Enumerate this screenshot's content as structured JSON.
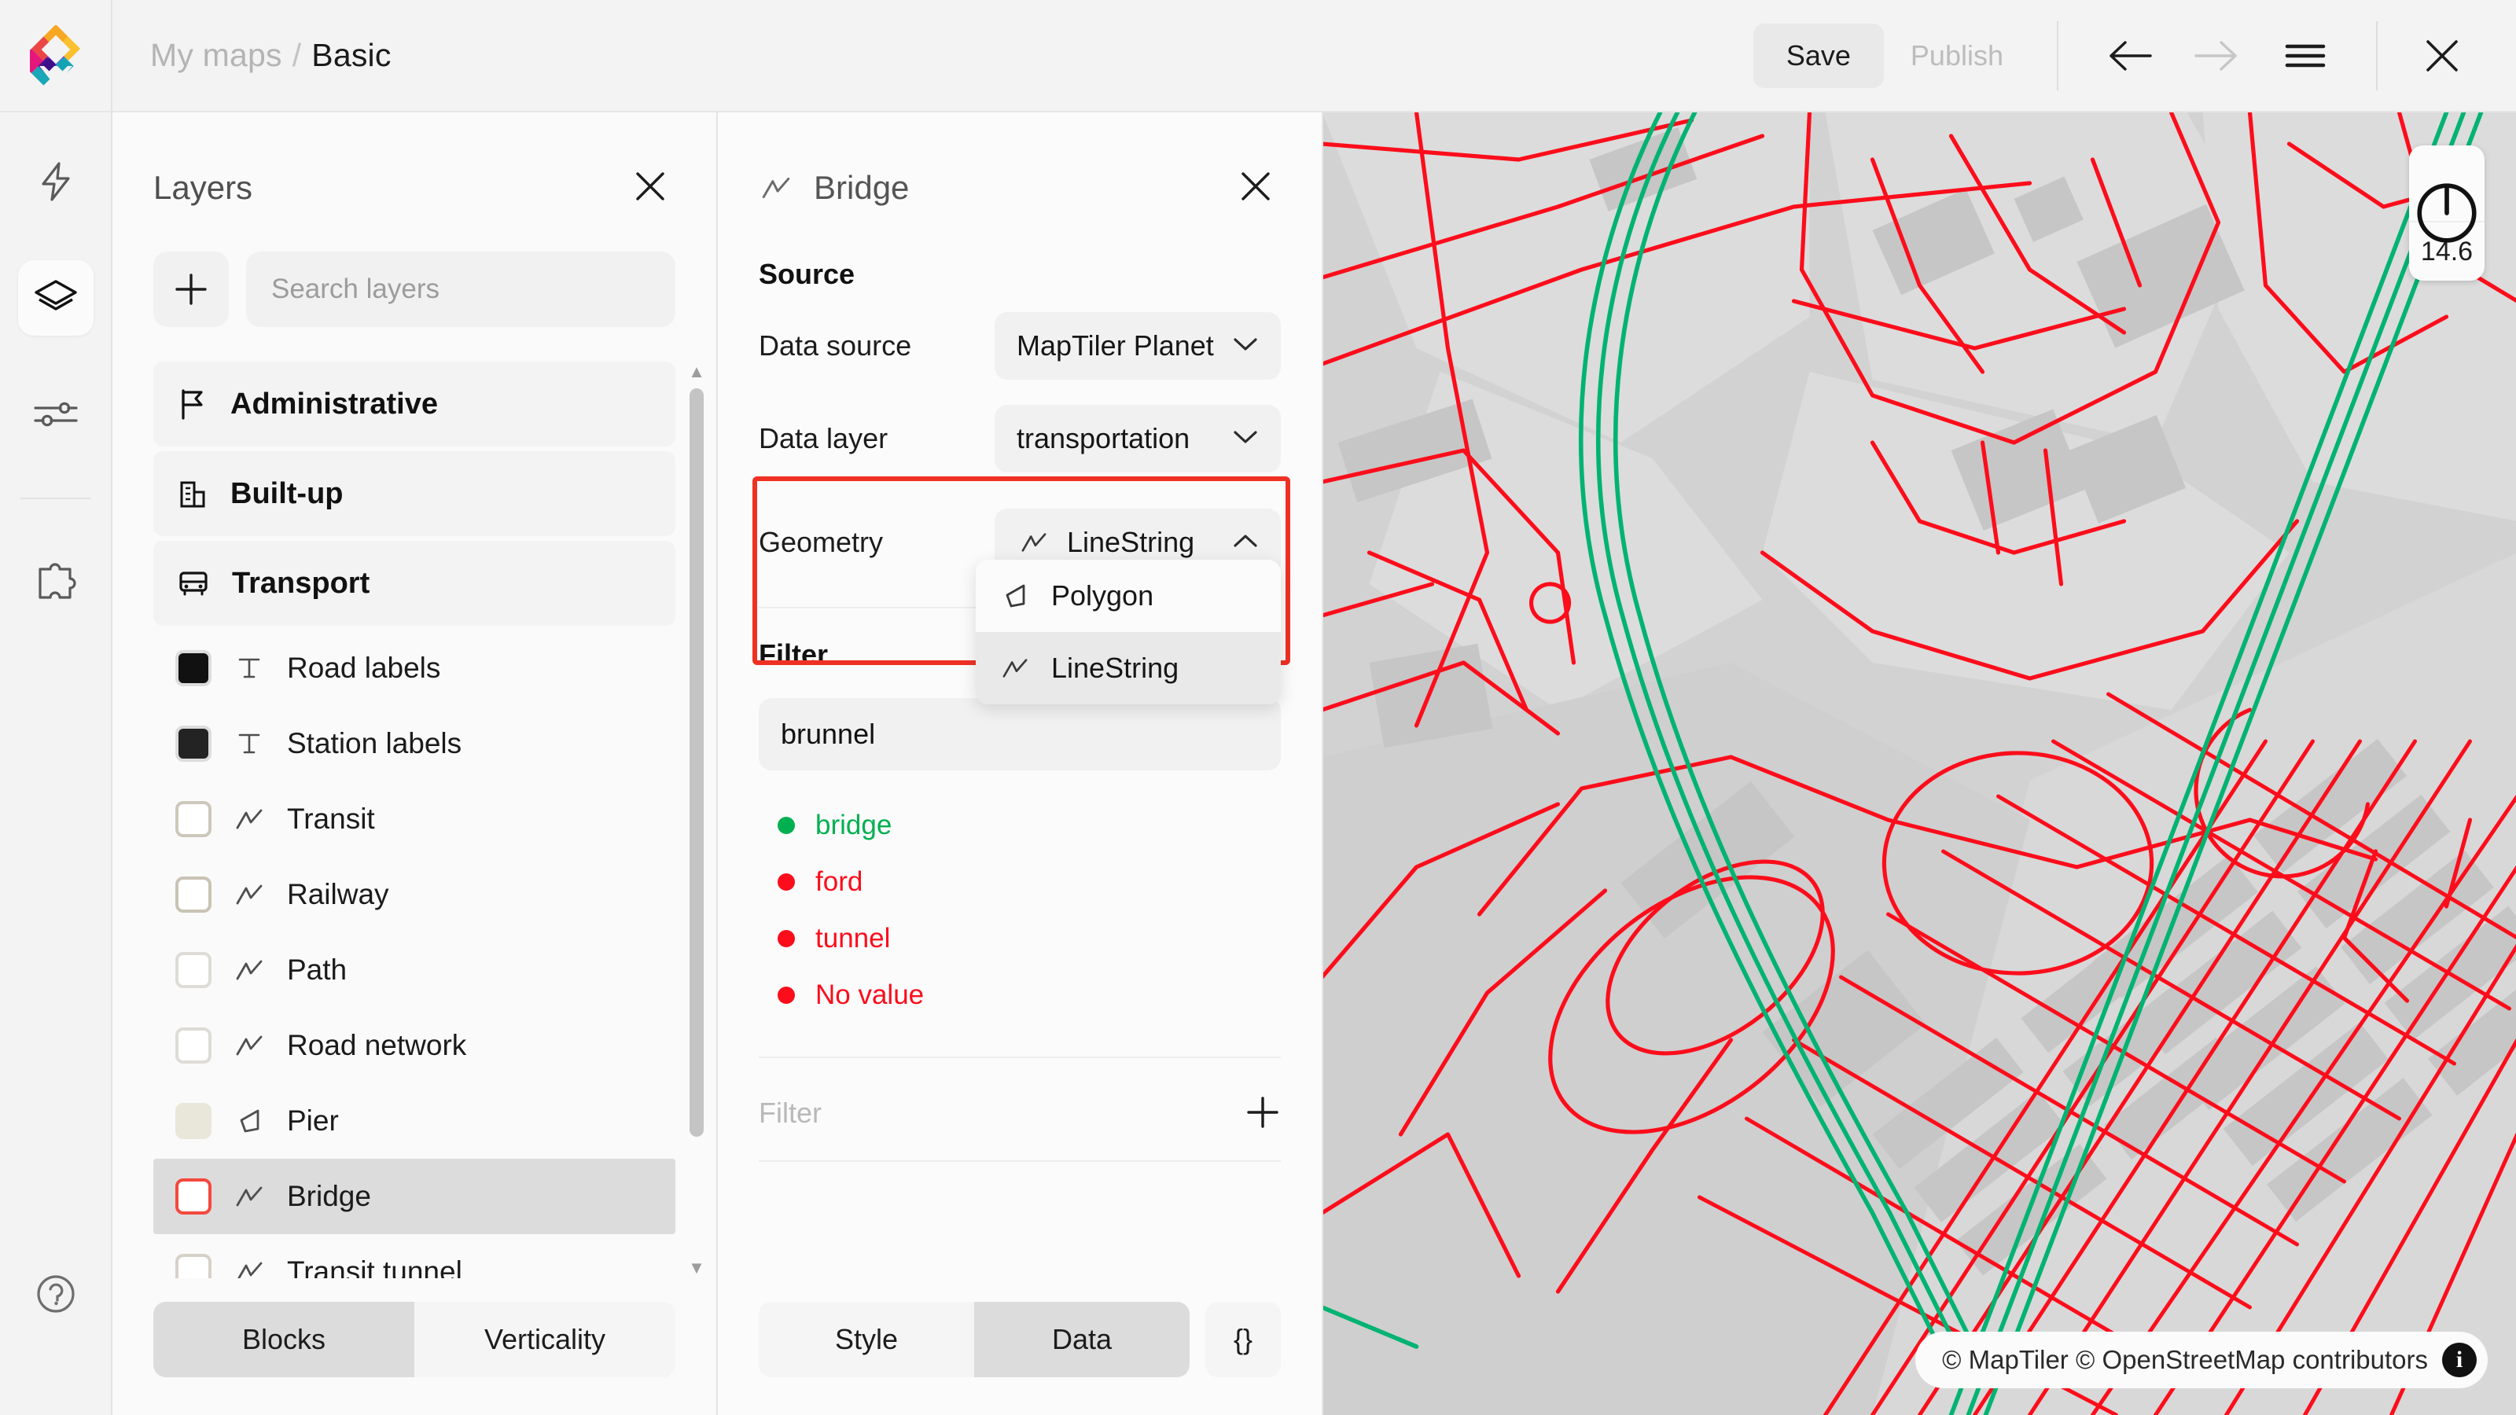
{
  "header": {
    "breadcrumb_root": "My maps",
    "breadcrumb_sep": "/",
    "breadcrumb_current": "Basic",
    "save_label": "Save",
    "publish_label": "Publish",
    "logo_name": "maptiler-logo"
  },
  "rail": {
    "items": [
      {
        "icon": "lightning-bolt-icon",
        "active": false
      },
      {
        "icon": "layers-icon",
        "active": true
      },
      {
        "icon": "sliders-icon",
        "active": false
      },
      {
        "icon": "puzzle-piece-icon",
        "active": false
      }
    ],
    "help_icon": "help-circle-icon"
  },
  "layers_panel": {
    "title": "Layers",
    "add_label": "+",
    "search_placeholder": "Search layers",
    "search_value": "",
    "groups": [
      {
        "label": "Administrative",
        "icon": "flag-icon"
      },
      {
        "label": "Built-up",
        "icon": "building-icon"
      },
      {
        "label": "Transport",
        "icon": "bus-icon"
      }
    ],
    "items": [
      {
        "label": "Road labels",
        "geom": "text-icon",
        "swatch": "#111111",
        "border": "#d9d6cd",
        "selected": false
      },
      {
        "label": "Station labels",
        "geom": "text-icon",
        "swatch": "#232323",
        "border": "#d9d6cd",
        "selected": false
      },
      {
        "label": "Transit",
        "geom": "linestring-icon",
        "swatch": "#ffffff",
        "border": "#cdc8bb",
        "selected": false
      },
      {
        "label": "Railway",
        "geom": "linestring-icon",
        "swatch": "#ffffff",
        "border": "#c9c3b4",
        "selected": false
      },
      {
        "label": "Path",
        "geom": "linestring-icon",
        "swatch": "#ffffff",
        "border": "#dedcd6",
        "selected": false
      },
      {
        "label": "Road network",
        "geom": "linestring-icon",
        "swatch": "#ffffff",
        "border": "#dedcd6",
        "selected": false
      },
      {
        "label": "Pier",
        "geom": "polygon-icon",
        "swatch": "#e8e7da",
        "border": "#e8e7da",
        "selected": false
      },
      {
        "label": "Bridge",
        "geom": "linestring-icon",
        "swatch": "#ffffff",
        "border": "#f4493c",
        "selected": true
      },
      {
        "label": "Transit tunnel",
        "geom": "linestring-icon",
        "swatch": "#ffffff",
        "border": "#d6d2c8",
        "selected": false
      }
    ],
    "tabs": [
      {
        "label": "Blocks",
        "active": true
      },
      {
        "label": "Verticality",
        "active": false
      }
    ]
  },
  "bridge_panel": {
    "title": "Bridge",
    "title_icon": "linestring-icon",
    "source_section": "Source",
    "fields": [
      {
        "label": "Data source",
        "value": "MapTiler Planet",
        "chevron": "chevron-down-icon"
      },
      {
        "label": "Data layer",
        "value": "transportation",
        "chevron": "chevron-down-icon"
      }
    ],
    "geometry": {
      "label": "Geometry",
      "value": "LineString",
      "icon": "linestring-icon",
      "chevron": "chevron-up-icon",
      "highlight_color": "#ef3124",
      "options": [
        {
          "label": "Polygon",
          "icon": "polygon-icon",
          "active": false
        },
        {
          "label": "LineString",
          "icon": "linestring-icon",
          "active": true
        }
      ]
    },
    "filter_section": "Filter",
    "property_value": "brunnel",
    "values": [
      {
        "label": "bridge",
        "color": "#00b050"
      },
      {
        "label": "ford",
        "color": "#fc0d1b"
      },
      {
        "label": "tunnel",
        "color": "#fc0d1b"
      },
      {
        "label": "No value",
        "color": "#fc0d1b"
      }
    ],
    "filter_add_label": "Filter",
    "filter_add_icon": "plus-icon",
    "tabs": [
      {
        "label": "Style",
        "active": false
      },
      {
        "label": "Data",
        "active": true
      }
    ],
    "json_label": "{}"
  },
  "map": {
    "zoom_level": "14.6",
    "compass_icon": "compass-reset-icon",
    "attribution": "© MapTiler © OpenStreetMap contributors",
    "info_label": "i",
    "colors": {
      "background": "#d2d2d2",
      "landuse": "#dcdcdc",
      "building": "#c6c6c6",
      "road": "#fc0d1b",
      "rail": "#00b372",
      "water": "#e7e7e7"
    }
  }
}
